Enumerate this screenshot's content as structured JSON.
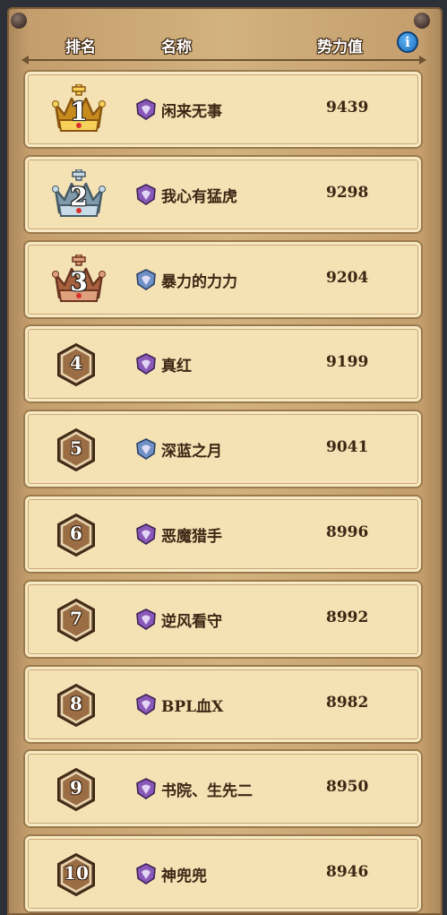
{
  "header": {
    "rank_label": "排名",
    "name_label": "名称",
    "power_label": "势力值",
    "info_glyph": "i"
  },
  "colors": {
    "gold": "#e0b23a",
    "silver": "#98b4c4",
    "bronze": "#b8775a",
    "hex_fill": "#9b6d45",
    "class_purple": "#8a58b8",
    "class_blue": "#6f90c4"
  },
  "rows": [
    {
      "rank": "1",
      "rank_style": "gold-crown",
      "class_icon": "purple-class-icon",
      "name": "闲来无事",
      "score": "9439"
    },
    {
      "rank": "2",
      "rank_style": "silver-crown",
      "class_icon": "purple-class-icon",
      "name": "我心有猛虎",
      "score": "9298"
    },
    {
      "rank": "3",
      "rank_style": "bronze-crown",
      "class_icon": "blue-class-icon",
      "name": "暴力的力力",
      "score": "9204"
    },
    {
      "rank": "4",
      "rank_style": "hexagon",
      "class_icon": "purple-class-icon",
      "name": "真红",
      "score": "9199"
    },
    {
      "rank": "5",
      "rank_style": "hexagon",
      "class_icon": "blue-class-icon",
      "name": "深蓝之月",
      "score": "9041"
    },
    {
      "rank": "6",
      "rank_style": "hexagon",
      "class_icon": "purple-class-icon",
      "name": "恶魔猎手",
      "score": "8996"
    },
    {
      "rank": "7",
      "rank_style": "hexagon",
      "class_icon": "purple-class-icon",
      "name": "逆风看守",
      "score": "8992"
    },
    {
      "rank": "8",
      "rank_style": "hexagon",
      "class_icon": "purple-class-icon",
      "name": "BPL血X",
      "score": "8982"
    },
    {
      "rank": "9",
      "rank_style": "hexagon",
      "class_icon": "purple-class-icon",
      "name": "书院、生先二",
      "score": "8950"
    },
    {
      "rank": "10",
      "rank_style": "hexagon",
      "class_icon": "purple-class-icon",
      "name": "神兜兜",
      "score": "8946"
    }
  ]
}
